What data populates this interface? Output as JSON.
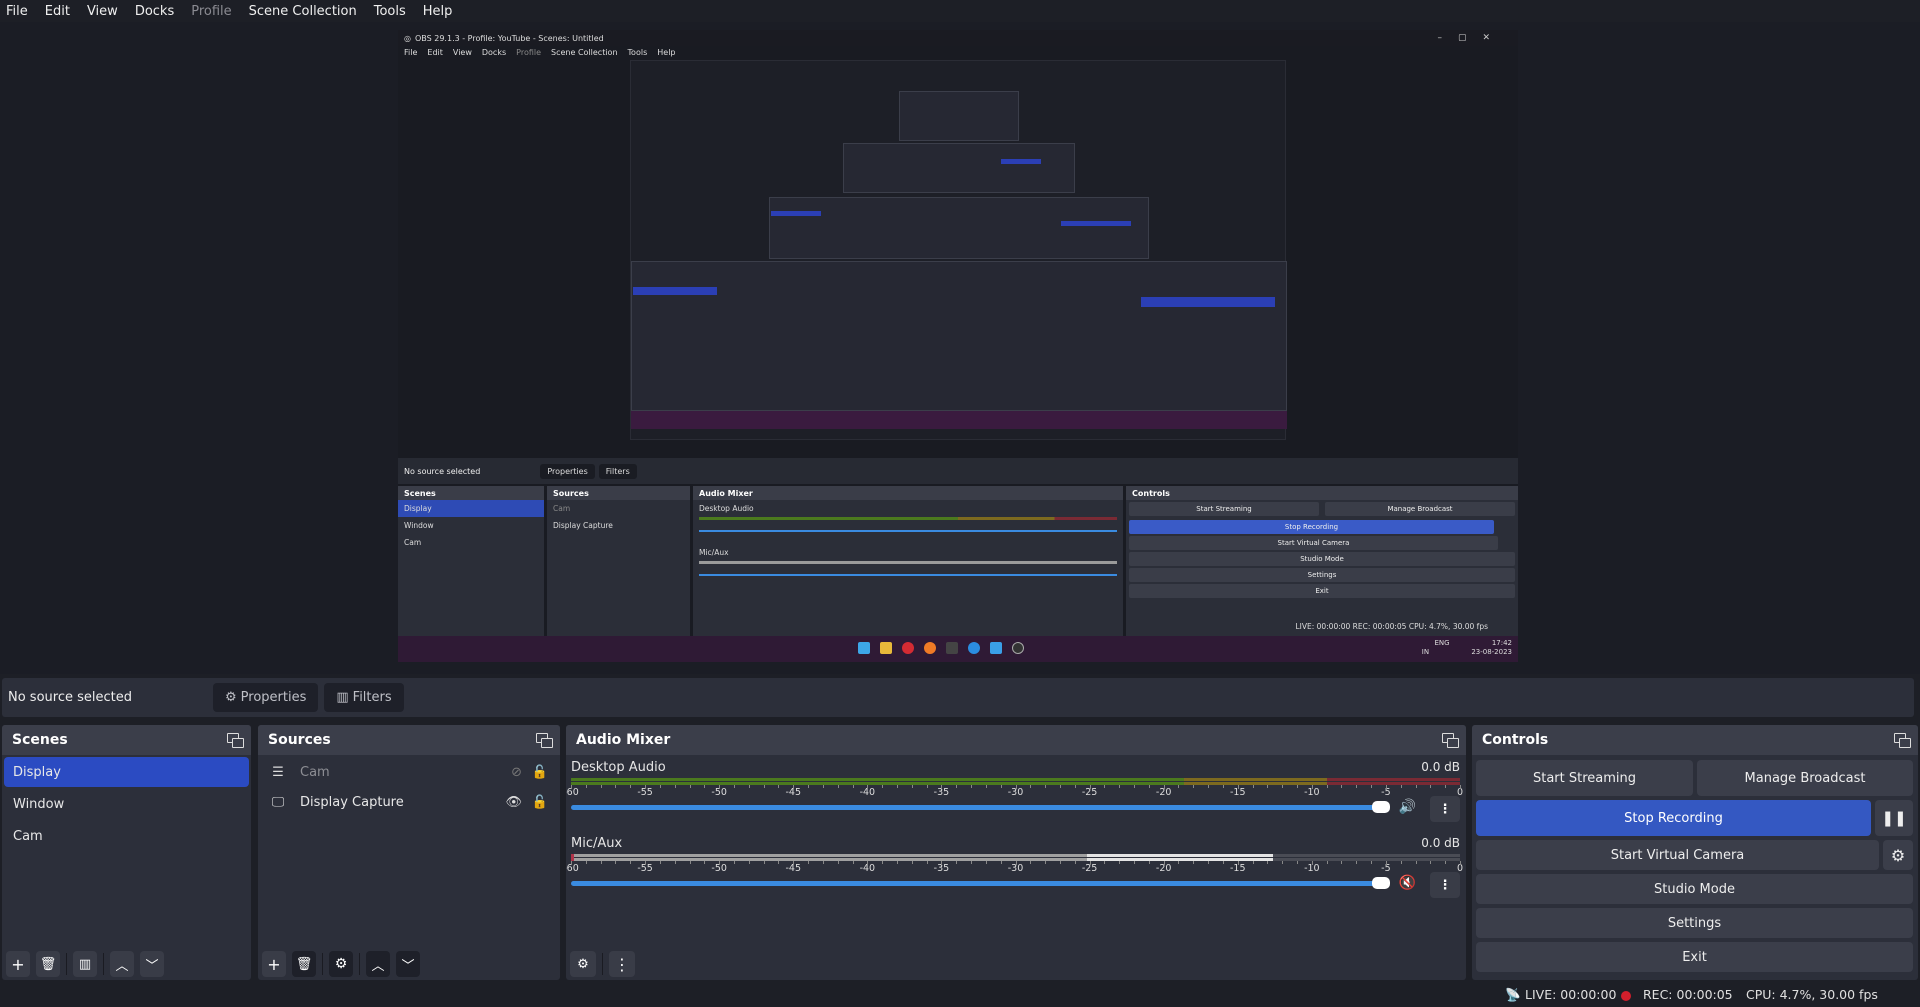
{
  "menu": [
    "File",
    "Edit",
    "View",
    "Docks",
    "Profile",
    "Scene Collection",
    "Tools",
    "Help"
  ],
  "menu_disabled": "Profile",
  "preview": {
    "window_title": "OBS 29.1.3 - Profile: YouTube - Scenes: Untitled",
    "menu": [
      "File",
      "Edit",
      "View",
      "Docks",
      "Profile",
      "Scene Collection",
      "Tools",
      "Help"
    ],
    "window_controls": [
      "minimize",
      "maximize",
      "close"
    ],
    "source_bar": {
      "label": "No source selected",
      "properties": "Properties",
      "filters": "Filters"
    },
    "docks": {
      "scenes_title": "Scenes",
      "sources_title": "Sources",
      "mixer_title": "Audio Mixer",
      "controls_title": "Controls",
      "scenes": [
        "Display",
        "Window",
        "Cam"
      ],
      "sources": [
        "Cam",
        "Display Capture"
      ],
      "channels": [
        "Desktop Audio",
        "Mic/Aux"
      ],
      "controls": [
        "Start Streaming",
        "Manage Broadcast",
        "Stop Recording",
        "Start Virtual Camera",
        "Studio Mode",
        "Settings",
        "Exit"
      ]
    },
    "status": "LIVE: 00:00:00   REC: 00:00:05   CPU: 4.7%, 30.00 fps",
    "taskbar": {
      "icons": [
        "windows-start",
        "file-explorer",
        "app-red",
        "firefox",
        "terminal",
        "app-blue",
        "app-w",
        "obs"
      ],
      "tray_lang": "ENG",
      "tray_region": "IN",
      "time": "17:42",
      "date": "23-08-2023"
    }
  },
  "source_bar": {
    "label": "No source selected",
    "properties": "Properties",
    "filters": "Filters"
  },
  "scenes": {
    "title": "Scenes",
    "items": [
      "Display",
      "Window",
      "Cam"
    ],
    "selected": "Display"
  },
  "sources": {
    "title": "Sources",
    "items": [
      {
        "name": "Cam",
        "type": "group",
        "visible": false,
        "locked": false
      },
      {
        "name": "Display Capture",
        "type": "display",
        "visible": true,
        "locked": false
      }
    ]
  },
  "mixer": {
    "title": "Audio Mixer",
    "ticks": [
      "-60",
      "-55",
      "-50",
      "-45",
      "-40",
      "-35",
      "-30",
      "-25",
      "-20",
      "-15",
      "-10",
      "-5",
      "0"
    ],
    "channels": [
      {
        "name": "Desktop Audio",
        "db": "0.0 dB",
        "muted": false,
        "volume_pct": 100
      },
      {
        "name": "Mic/Aux",
        "db": "0.0 dB",
        "muted": true,
        "volume_pct": 100
      }
    ]
  },
  "controls": {
    "title": "Controls",
    "start_streaming": "Start Streaming",
    "manage_broadcast": "Manage Broadcast",
    "stop_recording": "Stop Recording",
    "start_virtual_camera": "Start Virtual Camera",
    "studio_mode": "Studio Mode",
    "settings": "Settings",
    "exit": "Exit"
  },
  "status": {
    "live": "LIVE: 00:00:00",
    "rec": "REC: 00:00:05",
    "cpu": "CPU: 4.7%, 30.00 fps"
  },
  "colors": {
    "accent": "#3458c2",
    "scene_selected": "#2b4bc2",
    "volume": "#3a8be0",
    "rec_dot": "#d21f2c",
    "meter_green": "#4b7a1e",
    "meter_yellow": "#7d6a1f",
    "meter_red": "#7a2a34"
  }
}
